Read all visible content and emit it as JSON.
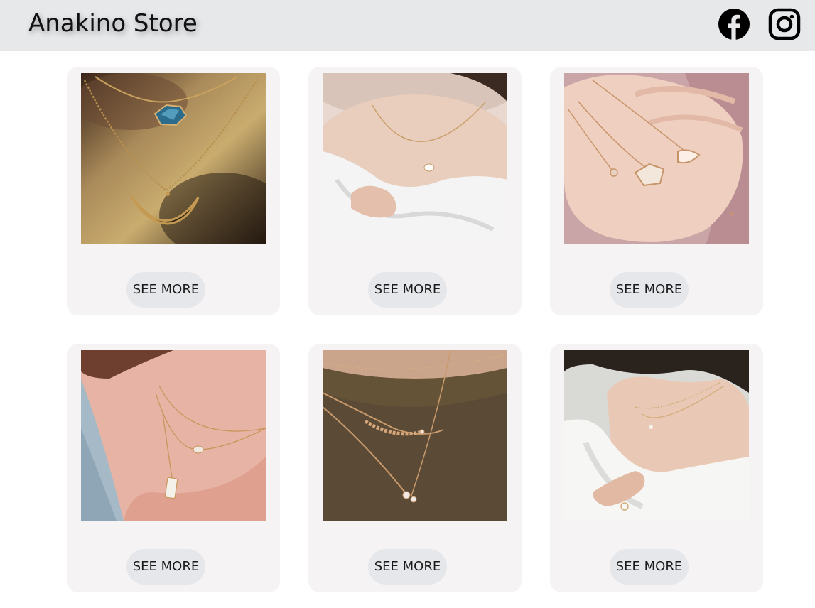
{
  "header": {
    "brand": "Anakino Store",
    "social": [
      {
        "name": "facebook",
        "icon": "facebook-icon"
      },
      {
        "name": "instagram",
        "icon": "instagram-icon"
      }
    ]
  },
  "colors": {
    "header_bg": "#e7e8ea",
    "card_bg": "#f5f3f4",
    "button_bg": "#e6e7ea"
  },
  "products": [
    {
      "image": "necklace with blue gem pendant and crescent moon pendant",
      "button_label": "SEE MORE"
    },
    {
      "image": "woman wearing fine chain necklace with white off-shoulder shirt",
      "button_label": "SEE MORE"
    },
    {
      "image": "rose gold necklaces held in an open palm",
      "button_label": "SEE MORE"
    },
    {
      "image": "layered necklaces on neck with light blue top",
      "button_label": "SEE MORE"
    },
    {
      "image": "layered gold necklaces over olive green top",
      "button_label": "SEE MORE"
    },
    {
      "image": "woman in white shirt wearing delicate layered necklaces",
      "button_label": "SEE MORE"
    }
  ]
}
